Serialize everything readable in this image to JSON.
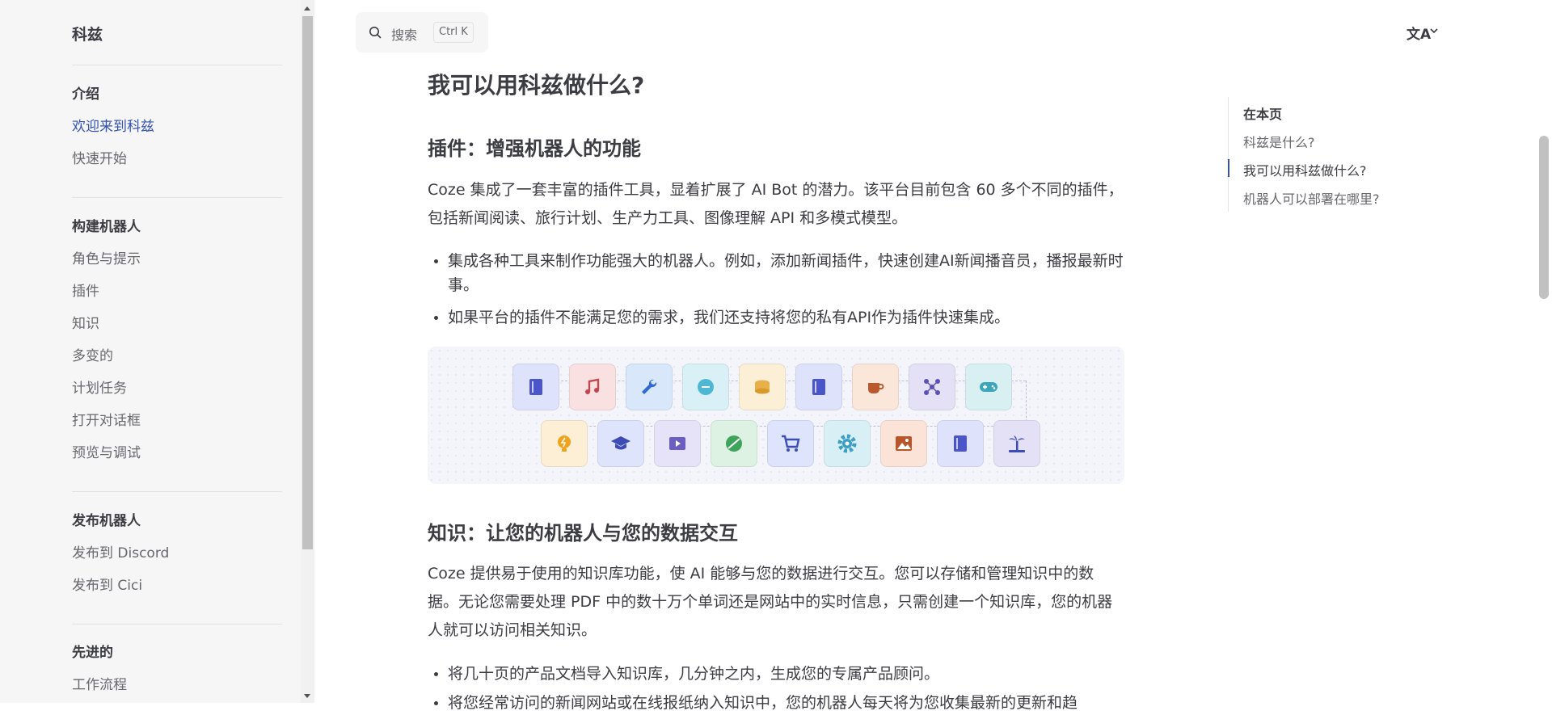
{
  "sidebar": {
    "brand": "科兹",
    "sections": [
      {
        "title": "介绍",
        "items": [
          "欢迎来到科兹",
          "快速开始"
        ]
      },
      {
        "title": "构建机器人",
        "items": [
          "角色与提示",
          "插件",
          "知识",
          "多变的",
          "计划任务",
          "打开对话框",
          "预览与调试"
        ]
      },
      {
        "title": "发布机器人",
        "items": [
          "发布到 Discord",
          "发布到 Cici"
        ]
      },
      {
        "title": "先进的",
        "items": [
          "工作流程"
        ]
      }
    ]
  },
  "search": {
    "label": "搜索",
    "shortcut": "Ctrl K"
  },
  "lang": {
    "glyph": "文A"
  },
  "content": {
    "h2": "我可以用科兹做什么?",
    "plugins": {
      "heading": "插件：增强机器人的功能",
      "para": "Coze 集成了一套丰富的插件工具，显着扩展了 AI Bot 的潜力。该平台目前包含 60 多个不同的插件，包括新闻阅读、旅行计划、生产力工具、图像理解 API 和多模式模型。",
      "bullets": [
        "集成各种工具来制作功能强大的机器人。例如，添加新闻插件，快速创建AI新闻播音员，播报最新时事。",
        "如果平台的插件不能满足您的需求，我们还支持将您的私有API作为插件快速集成。"
      ]
    },
    "knowledge": {
      "heading": "知识：让您的机器人与您的数据交互",
      "para": "Coze 提供易于使用的知识库功能，使 AI 能够与您的数据进行交互。您可以存储和管理知识中的数据。无论您需要处理 PDF 中的数十万个单词还是网站中的实时信息，只需创建一个知识库，您的机器人就可以访问相关知识。",
      "bullets": [
        "将几十页的产品文档导入知识库，几分钟之内，生成您的专属产品顾问。",
        "将您经常访问的新闻网站或在线报纸纳入知识中，您的机器人每天将为您收集最新的更新和趋"
      ]
    }
  },
  "toc": {
    "title": "在本页",
    "items": [
      "科兹是什么?",
      "我可以用科兹做什么?",
      "机器人可以部署在哪里?"
    ]
  },
  "colors": {
    "accent": "#3451b2",
    "sidebar_bg": "#f6f6f7",
    "text": "#3c3c43",
    "muted": "#67676c"
  },
  "plugin_icons": {
    "row1": [
      "book-icon",
      "music-icon",
      "wrench-icon",
      "chat-icon",
      "coins-icon",
      "book-icon",
      "coffee-icon",
      "network-icon",
      "gamepad-icon"
    ],
    "row2": [
      "bulb-icon",
      "graduation-icon",
      "video-icon",
      "ball-icon",
      "cart-icon",
      "gear-icon",
      "image-icon",
      "book-icon",
      "palm-icon"
    ]
  }
}
